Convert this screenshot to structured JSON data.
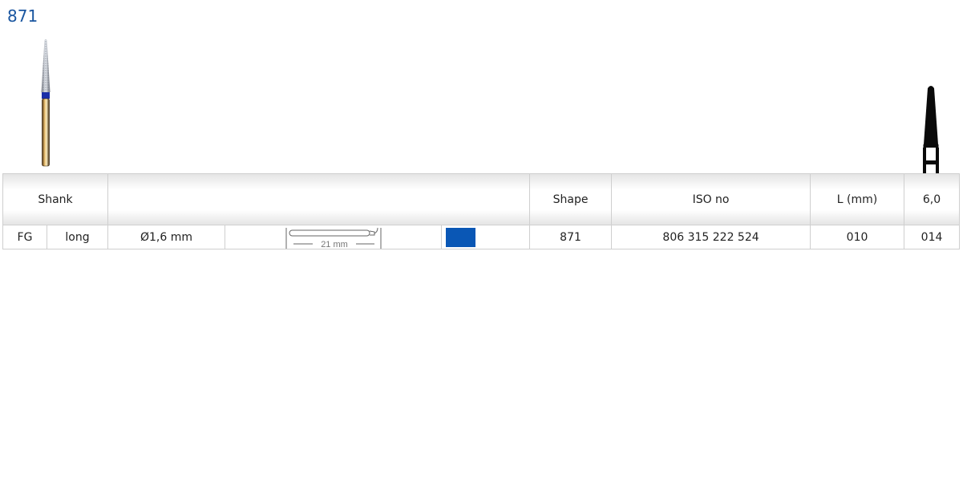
{
  "product": {
    "title": "871"
  },
  "images": {
    "bur_photo": "bur-photo-icon",
    "shape_silhouette": "bur-silhouette-icon"
  },
  "table": {
    "headers": {
      "shank": "Shank",
      "shape": "Shape",
      "iso": "ISO no",
      "length": "L (mm)",
      "size": "6,0"
    },
    "row": {
      "shank_type": "FG",
      "shank_length": "long",
      "diameter": "Ø1,6 mm",
      "overall_length": "21 mm",
      "ring_color": "#0a57b5",
      "shape": "871",
      "iso_no": "806 315 222 524",
      "l_mm": "010",
      "size_code": "014"
    }
  }
}
